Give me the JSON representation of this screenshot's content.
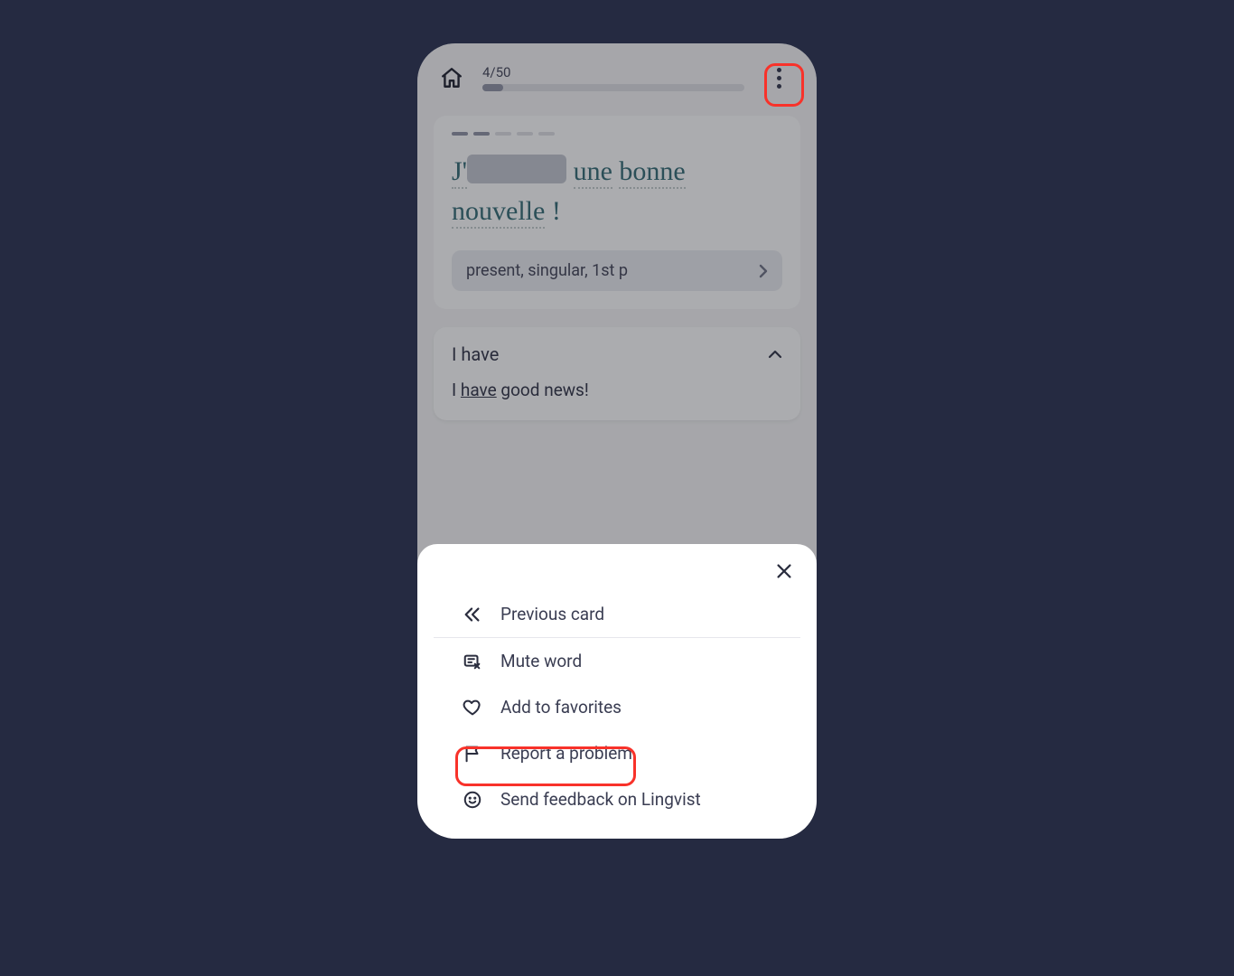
{
  "topbar": {
    "progress_label": "4/50",
    "progress_percent": 8
  },
  "card": {
    "sentence_prefix": "J'",
    "sentence_words": [
      "une",
      "bonne",
      "nouvelle",
      "!"
    ],
    "hint": "present, singular, 1st p"
  },
  "translation": {
    "header": "I have",
    "body_prefix": "I ",
    "body_underlined": "have",
    "body_suffix": " good news!"
  },
  "menu": {
    "previous": "Previous card",
    "mute": "Mute word",
    "favorites": "Add to favorites",
    "report": "Report a problem",
    "feedback": "Send feedback on Lingvist"
  }
}
